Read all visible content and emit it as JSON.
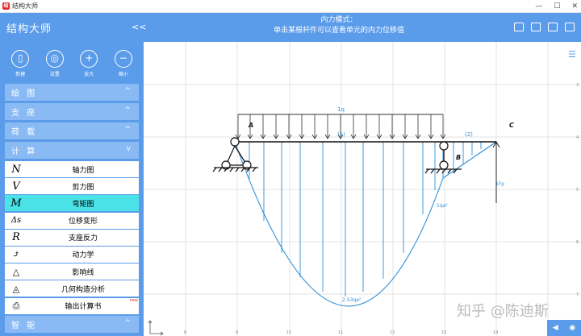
{
  "window": {
    "title": "结构大师",
    "controls": [
      "—",
      "☐",
      "✕"
    ]
  },
  "header": {
    "app_name": "结构大师",
    "collapse": "<<",
    "mode_line1": "内力模式：",
    "mode_line2": "单击某根杆件可以查看单元的内力位移值"
  },
  "tools": [
    {
      "label": "新建",
      "glyph": "▯"
    },
    {
      "label": "设置",
      "glyph": "◎"
    },
    {
      "label": "放大",
      "glyph": "+"
    },
    {
      "label": "缩小",
      "glyph": "−"
    }
  ],
  "sections": {
    "draw": {
      "label": "绘 图",
      "chev": "^"
    },
    "support": {
      "label": "支 座",
      "chev": "^"
    },
    "load": {
      "label": "荷 载",
      "chev": "^"
    },
    "calc": {
      "label": "计 算",
      "chev": "v"
    },
    "smart": {
      "label": "智 能",
      "chev": "^"
    }
  },
  "calc_items": [
    {
      "sym": "N",
      "label": "轴力图"
    },
    {
      "sym": "V",
      "label": "剪力图"
    },
    {
      "sym": "M",
      "label": "弯矩图"
    },
    {
      "sym": "Δs",
      "label": "位移变形"
    },
    {
      "sym": "R",
      "label": "支座反力"
    },
    {
      "sym": "⤴",
      "label": "动力学"
    },
    {
      "sym": "△",
      "label": "影响线"
    },
    {
      "sym": "◬",
      "label": "几何构造分析"
    },
    {
      "sym": "⎙",
      "label": "输出计算书",
      "tag": "new"
    }
  ],
  "diagram": {
    "load_label": "1q",
    "node_a": "A",
    "node_b": "B",
    "node_c": "C",
    "elem_1": "(1)",
    "elem_2": "(2)",
    "point_load": "1Fp",
    "moment_b": "1qa²",
    "moment_max": "2.53qa²",
    "x_ticks": [
      "8",
      "9",
      "10",
      "11",
      "12",
      "13",
      "14"
    ],
    "y_ticks": [
      "3",
      "4",
      "5",
      "6",
      "7"
    ]
  },
  "watermark": "知乎 @陈迪斯",
  "colors": {
    "accent": "#5b9cea",
    "active": "#4be3e8",
    "moment": "#2e8fd8"
  }
}
